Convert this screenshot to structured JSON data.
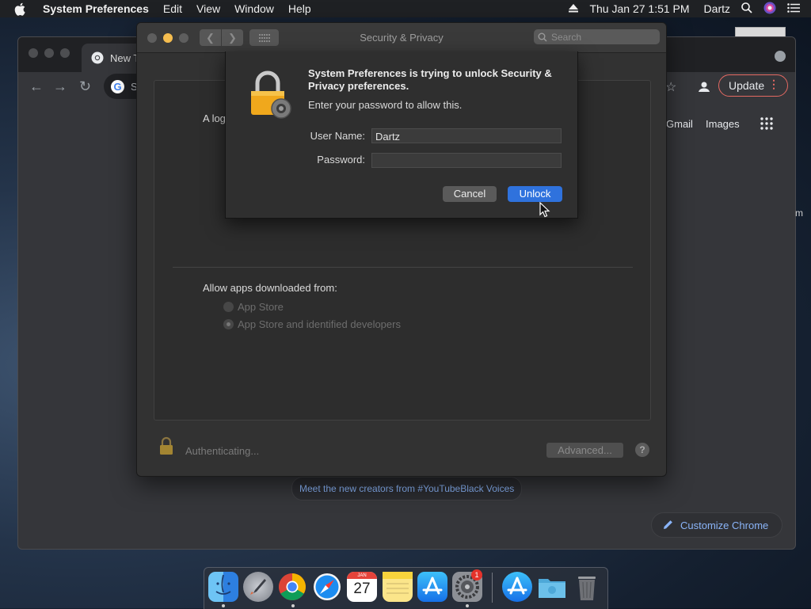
{
  "menubar": {
    "app_name": "System Preferences",
    "items": [
      "Edit",
      "View",
      "Window",
      "Help"
    ],
    "clock": "Thu Jan 27  1:51 PM",
    "user": "Dartz"
  },
  "chrome": {
    "tab_title": "New Ta",
    "omnibox_text": "S",
    "update_label": "Update",
    "gmail": "Gmail",
    "images": "Images",
    "news_text": "Meet the new creators from #YouTubeBlack Voices",
    "customize_label": "Customize Chrome",
    "edge_letter": "m"
  },
  "sysprefs": {
    "title": "Security & Privacy",
    "search_placeholder": "Search",
    "login_text": "A log",
    "allow_label": "Allow apps downloaded from:",
    "radio_app_store": "App Store",
    "radio_identified": "App Store and identified developers",
    "selected_radio": "App Store and identified developers",
    "authenticating": "Authenticating...",
    "advanced_label": "Advanced...",
    "help_label": "?"
  },
  "auth_sheet": {
    "heading": "System Preferences is trying to unlock Security & Privacy preferences.",
    "subtext": "Enter your password to allow this.",
    "username_label": "User Name:",
    "username_value": "Dartz",
    "password_label": "Password:",
    "password_value": "",
    "cancel_label": "Cancel",
    "unlock_label": "Unlock"
  },
  "dock": {
    "apps": [
      "finder",
      "launchpad",
      "chrome",
      "safari",
      "calendar",
      "notes",
      "app-store",
      "system-preferences",
      "app-store-downloads",
      "downloads-folder",
      "trash"
    ],
    "calendar_month": "JAN",
    "calendar_day": "27",
    "sysprefs_badge": "1"
  },
  "colors": {
    "accent_blue": "#2f72dd",
    "minimize_yellow": "#f5bd4f",
    "update_red": "#e46962",
    "link_blue": "#8ab4f8"
  }
}
